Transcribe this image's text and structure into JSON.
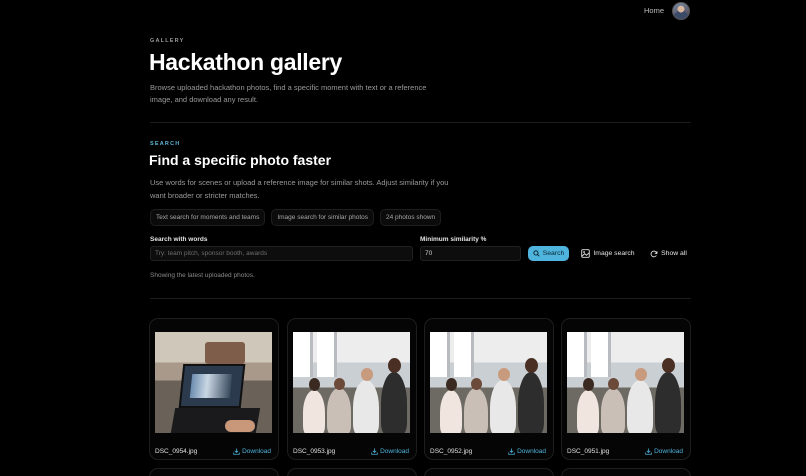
{
  "nav": {
    "home": "Home"
  },
  "hero": {
    "eyebrow": "GALLERY",
    "title": "Hackathon gallery",
    "description": "Browse uploaded hackathon photos, find a specific moment with text or a reference image, and download any result."
  },
  "search": {
    "eyebrow": "SEARCH",
    "title": "Find a specific photo faster",
    "description": "Use words for scenes or upload a reference image for similar shots. Adjust similarity if you want broader or stricter matches.",
    "pills": [
      "Text search for moments and teams",
      "Image search for similar photos",
      "24 photos shown"
    ],
    "words_label": "Search with words",
    "words_placeholder": "Try: team pitch, sponsor booth, awards",
    "similarity_label": "Minimum similarity %",
    "similarity_value": "70",
    "search_button": "Search",
    "image_search_button": "Image search",
    "show_all_button": "Show all",
    "status": "Showing the latest uploaded photos."
  },
  "photos": [
    {
      "filename": "DSC_0954.jpg",
      "download": "Download",
      "scene": "laptop"
    },
    {
      "filename": "DSC_0953.jpg",
      "download": "Download",
      "scene": "group"
    },
    {
      "filename": "DSC_0952.jpg",
      "download": "Download",
      "scene": "group"
    },
    {
      "filename": "DSC_0951.jpg",
      "download": "Download",
      "scene": "group"
    }
  ],
  "colors": {
    "accent": "#4fb5de",
    "background": "#000000",
    "muted": "#9a9a9a"
  }
}
